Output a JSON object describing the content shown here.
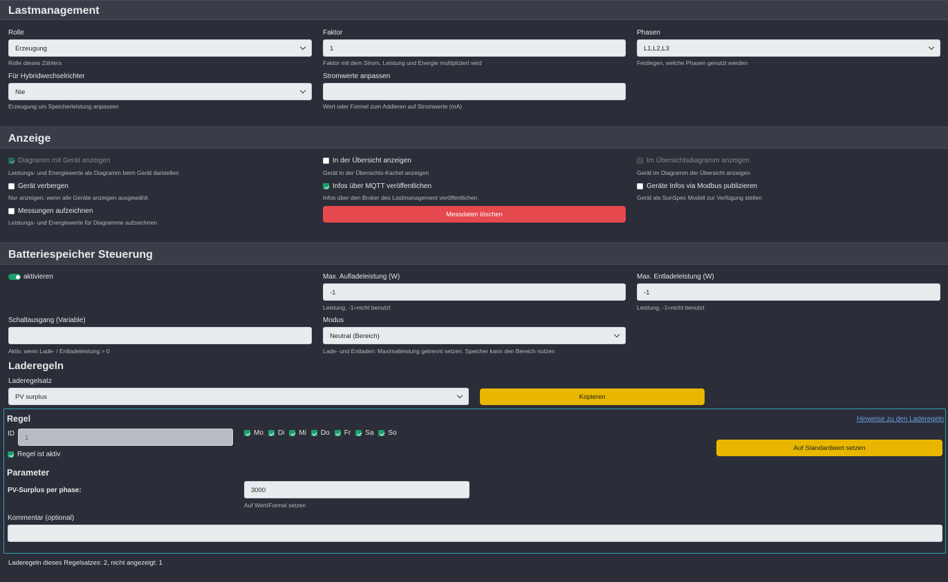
{
  "lastmanagement": {
    "title": "Lastmanagement",
    "rolle": {
      "label": "Rolle",
      "value": "Erzeugung",
      "hint": "Rolle dieses Zählers"
    },
    "faktor": {
      "label": "Faktor",
      "value": "1",
      "hint": "Faktor mit dem Strom, Leistung und Energie multipliziert wird"
    },
    "phasen": {
      "label": "Phasen",
      "value": "L1,L2,L3",
      "hint": "Festlegen, welche Phasen genutzt werden"
    },
    "hybrid": {
      "label": "Für Hybridwechselrichter",
      "value": "Nie",
      "hint": "Erzeugung um Speicherleistung anpassen"
    },
    "stromwerte": {
      "label": "Stromwerte anpassen",
      "value": "",
      "hint": "Wert oder Formel zum Addieren auf Stromwerte (mA)"
    }
  },
  "anzeige": {
    "title": "Anzeige",
    "diagramm": {
      "label": "Diagramm mit Gerät anzeigen",
      "hint": "Leistungs- und Energiewerte als Diagramm beim Gerät darstellen",
      "checked": true
    },
    "uebersicht": {
      "label": "In der Übersicht anzeigen",
      "hint": "Gerät in der Übersichts-Kachel anzeigen",
      "checked": false
    },
    "uebersichtsdiagramm": {
      "label": "Im Übersichtsdiagramm anzeigen",
      "hint": "Gerät im Diagramm der Übersicht anzeigen",
      "checked": false
    },
    "verbergen": {
      "label": "Gerät verbergen",
      "hint": "Nur anzeigen, wenn alle Geräte anzeigen ausgewählt",
      "checked": false
    },
    "mqtt": {
      "label": "Infos über MQTT veröffentlichen",
      "hint": "Infos über den Broker des Lastmanagement veröffentlichen",
      "checked": true
    },
    "modbus": {
      "label": "Geräte Infos via Modbus publizieren",
      "hint": "Gerät als SunSpec Modell zur Verfügung stellen",
      "checked": false
    },
    "messungen": {
      "label": "Messungen aufzeichnen",
      "hint": "Leistungs- und Energiewerte für Diagramme aufzeichnen",
      "checked": false
    },
    "delete_button": "Messdaten löschen"
  },
  "batterie": {
    "title": "Batteriespeicher Steuerung",
    "aktivieren": "aktivieren",
    "max_auflade": {
      "label": "Max. Aufladeleistung (W)",
      "value": "-1",
      "hint": "Leistung, -1=nicht benutzt"
    },
    "max_entlade": {
      "label": "Max. Entladeleistung (W)",
      "value": "-1",
      "hint": "Leistung, -1=nicht benutzt"
    },
    "schaltausgang": {
      "label": "Schaltausgang (Variable)",
      "value": "",
      "hint": "Aktiv, wenn Lade- / Entladeleistung > 0"
    },
    "modus": {
      "label": "Modus",
      "value": "Neutral (Bereich)",
      "hint": "Lade- und Entladen: Maximalleistung getrennt setzen. Speicher kann den Bereich nutzen"
    }
  },
  "laderegeln": {
    "title": "Laderegeln",
    "regelsatz_label": "Laderegelsatz",
    "regelsatz_value": "PV surplus",
    "kopieren": "Kopieren",
    "regel": {
      "title": "Regel",
      "hinweise_link": "Hinweise zu den Laderegeln",
      "id_label": "ID",
      "id_value": "1",
      "days": [
        {
          "label": "Mo",
          "checked": true
        },
        {
          "label": "Di",
          "checked": true
        },
        {
          "label": "Mi",
          "checked": true
        },
        {
          "label": "Do",
          "checked": true
        },
        {
          "label": "Fr",
          "checked": true
        },
        {
          "label": "Sa",
          "checked": true
        },
        {
          "label": "So",
          "checked": true
        }
      ],
      "aktiv_label": "Regel ist aktiv",
      "standard_button": "Auf Standardwert setzen",
      "parameter_title": "Parameter",
      "pv_label": "PV-Surplus per phase:",
      "pv_value": "3000",
      "pv_hint": "Auf Wert/Formel setzen",
      "kommentar_label": "Kommentar (optional)",
      "kommentar_value": ""
    },
    "footer": "Laderegeln dieses Regelsatzes: 2, nicht angezeigt: 1"
  }
}
